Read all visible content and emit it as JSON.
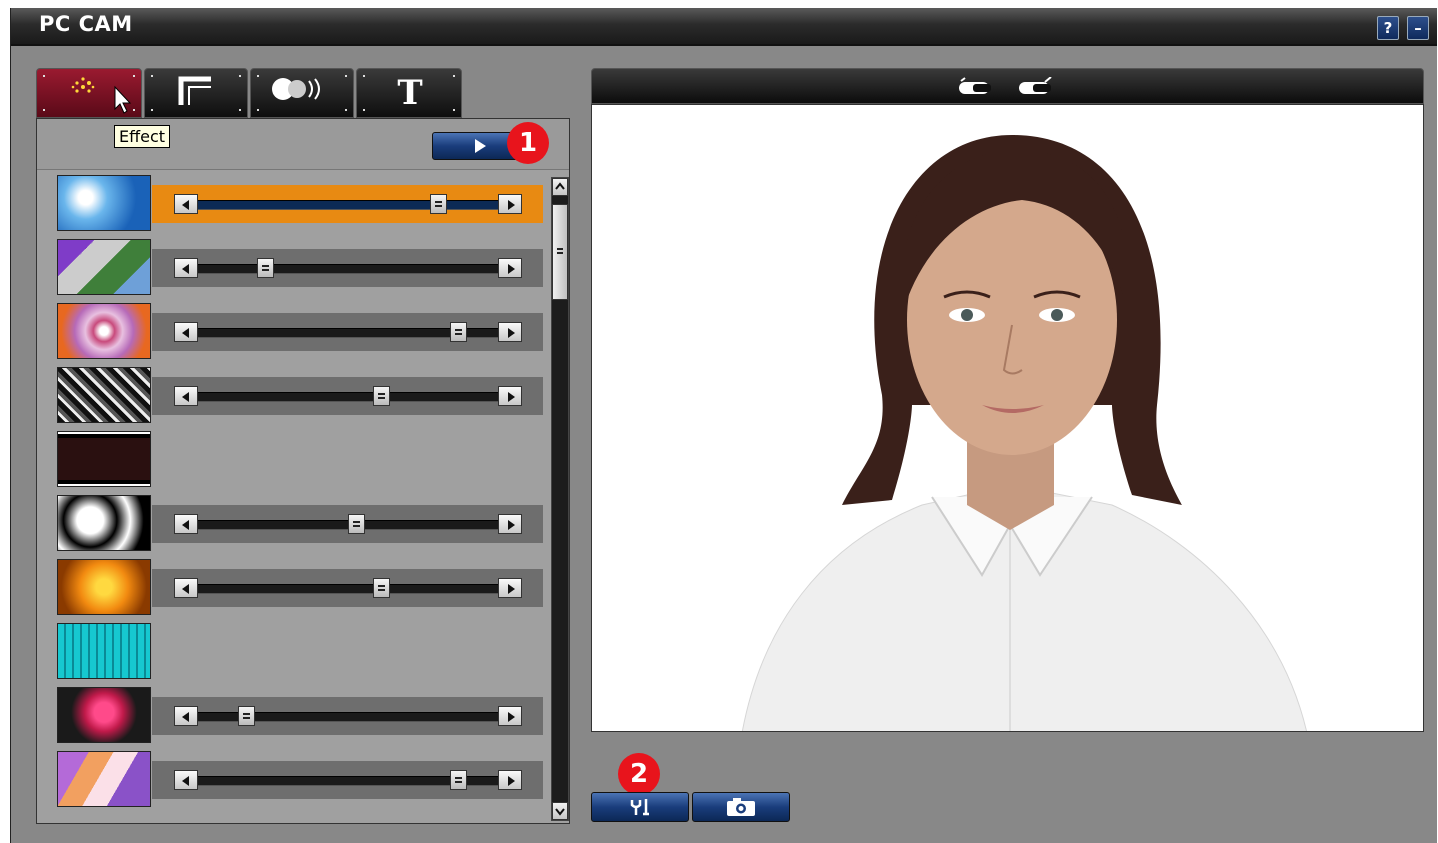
{
  "window": {
    "title": "PC CAM",
    "help_label": "?",
    "minimize_label": "–"
  },
  "tabs": [
    {
      "name": "Effect",
      "icon": "sparkle-wand-icon",
      "active": true
    },
    {
      "name": "Frame",
      "icon": "frame-corner-icon",
      "active": false
    },
    {
      "name": "Sound",
      "icon": "speaker-wave-icon",
      "active": false
    },
    {
      "name": "Text",
      "icon": "text-t-icon",
      "active": false
    }
  ],
  "tooltip": "Effect",
  "callouts": {
    "one": "1",
    "two": "2"
  },
  "effects": [
    {
      "name": "bubble",
      "level": 0.82,
      "selected": true
    },
    {
      "name": "mosaic",
      "level": 0.21
    },
    {
      "name": "swirl",
      "level": 0.89
    },
    {
      "name": "emboss",
      "level": 0.62
    },
    {
      "name": "old-film",
      "level": null
    },
    {
      "name": "black-white",
      "level": 0.53
    },
    {
      "name": "sepia-flower",
      "level": 0.62
    },
    {
      "name": "grid-tiles",
      "level": null
    },
    {
      "name": "pink-flower",
      "level": 0.14
    },
    {
      "name": "color-cells",
      "level": 0.89
    }
  ],
  "preview": {
    "toolbar_icons": [
      "camera-icon",
      "camera-settings-icon"
    ]
  },
  "bottom_buttons": [
    {
      "name": "settings",
      "icon": "tools-icon"
    },
    {
      "name": "snapshot",
      "icon": "camera-snapshot-icon"
    }
  ],
  "colors": {
    "active_tab": "#8c1428",
    "selected_row": "#e88a12",
    "button_blue": "#1a3d7c",
    "badge_red": "#e8141c"
  }
}
